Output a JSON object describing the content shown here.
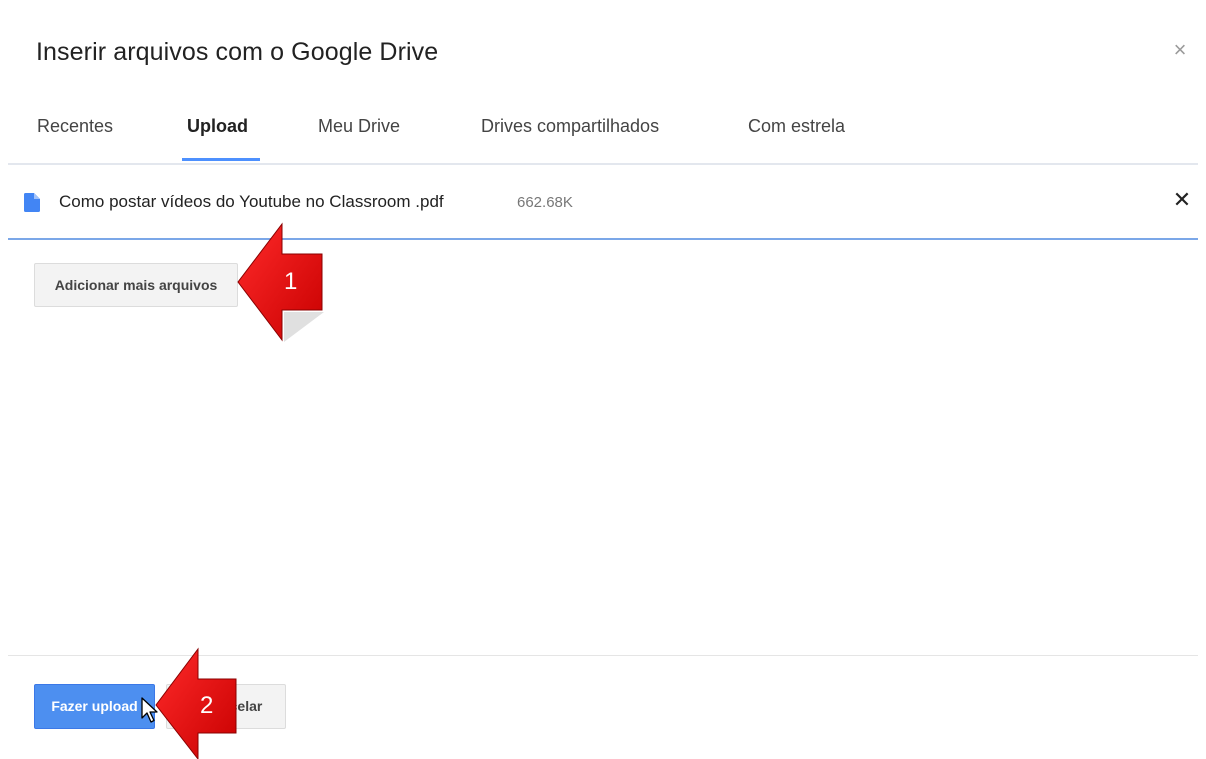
{
  "dialog": {
    "title": "Inserir arquivos com o Google Drive",
    "close_glyph": "×"
  },
  "tabs": [
    {
      "label": "Recentes",
      "active": false
    },
    {
      "label": "Upload",
      "active": true
    },
    {
      "label": "Meu Drive",
      "active": false
    },
    {
      "label": "Drives compartilhados",
      "active": false
    },
    {
      "label": "Com estrela",
      "active": false
    }
  ],
  "file": {
    "name": "Como postar vídeos do Youtube no Classroom .pdf",
    "size": "662.68K",
    "icon": "document-icon",
    "remove_glyph": "✕"
  },
  "buttons": {
    "add_more": "Adicionar mais arquivos",
    "upload": "Fazer upload",
    "cancel_visible": "celar"
  },
  "annotations": {
    "callout_1": "1",
    "callout_2": "2",
    "color": "#e20e0e"
  },
  "colors": {
    "accent": "#4d90fe",
    "upload_button": "#4d8ff0"
  }
}
